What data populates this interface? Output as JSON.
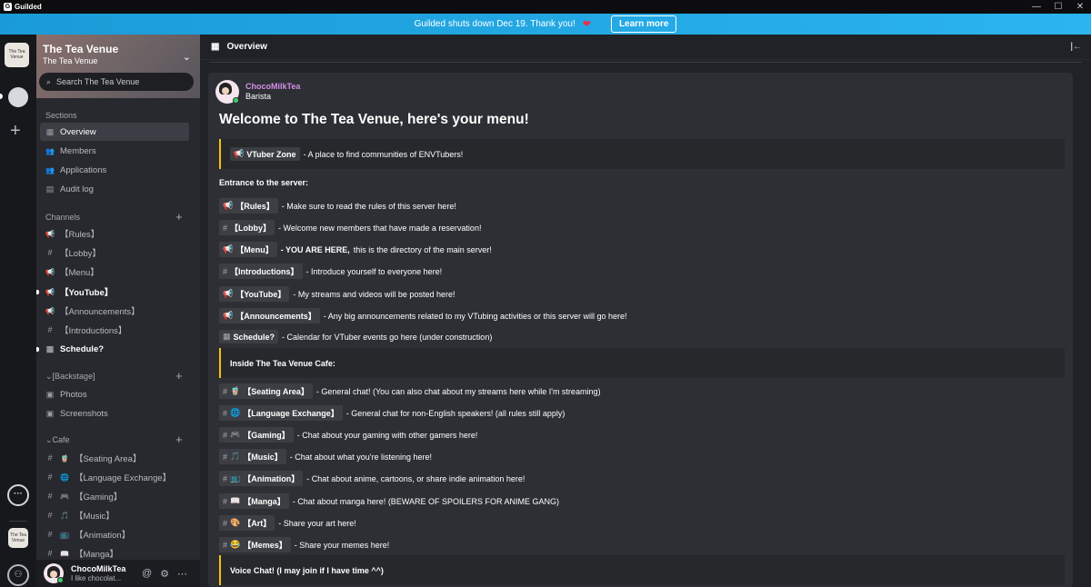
{
  "titlebar": {
    "app_name": "Guilded",
    "minimize": "—",
    "maximize": "☐",
    "close": "✕"
  },
  "banner": {
    "text": "Guilded shuts down Dec 19. Thank you!",
    "heart": "❤",
    "button": "Learn more"
  },
  "rail": {
    "server_tile_text": "The Tea Venue",
    "plus": "+",
    "chat_icon": "chat-bubble-icon"
  },
  "sidebar": {
    "server_name": "The Tea Venue",
    "server_subtitle": "The Tea Venue",
    "search_placeholder": "Search The Tea Venue",
    "sections_label": "Sections",
    "sections": [
      {
        "label": "Overview",
        "icon": "▦"
      },
      {
        "label": "Members",
        "icon": "👥"
      },
      {
        "label": "Applications",
        "icon": "👥"
      },
      {
        "label": "Audit log",
        "icon": "▤"
      }
    ],
    "channels_label": "Channels",
    "channels": [
      {
        "label": "【Rules】",
        "icon": "📢"
      },
      {
        "label": "【Lobby】",
        "icon": "#"
      },
      {
        "label": "【Menu】",
        "icon": "📢"
      },
      {
        "label": "【YouTube】",
        "icon": "📢"
      },
      {
        "label": "【Announcements】",
        "icon": "📢"
      },
      {
        "label": "【Introductions】",
        "icon": "#"
      },
      {
        "label": "Schedule?",
        "icon": "▦"
      }
    ],
    "backstage_label": "[Backstage]",
    "backstage": [
      {
        "label": "Photos",
        "icon": "▣"
      },
      {
        "label": "Screenshots",
        "icon": "▣"
      }
    ],
    "cafe_label": "Cafe",
    "cafe": [
      {
        "label": "【Seating Area】",
        "icon": "#",
        "emoji": "🧋"
      },
      {
        "label": "【Language Exchange】",
        "icon": "#",
        "emoji": "🌐"
      },
      {
        "label": "【Gaming】",
        "icon": "#",
        "emoji": "🎮"
      },
      {
        "label": "【Music】",
        "icon": "#",
        "emoji": "🎵"
      },
      {
        "label": "【Animation】",
        "icon": "#",
        "emoji": "📺"
      },
      {
        "label": "【Manga】",
        "icon": "#",
        "emoji": "📖"
      }
    ],
    "user": {
      "name": "ChocoMilkTea",
      "status": "I like chocolat...",
      "icons": [
        "@",
        "⚙",
        "⋯"
      ]
    }
  },
  "main": {
    "title": "Overview",
    "post": {
      "author": "ChocoMilkTea",
      "role": "Barista",
      "heading": "Welcome to The Tea Venue, here's your menu!",
      "vtuber_zone": {
        "tag": "VTuber Zone",
        "icon": "📢",
        "text": "- A place to find communities of ENVTubers!"
      },
      "entrance_label": "Entrance to the server:",
      "entrance": [
        {
          "icon": "📢",
          "tag": "【Rules】",
          "text": "- Make sure to read the rules of this server here!"
        },
        {
          "icon": "#",
          "tag": "【Lobby】",
          "text": "- Welcome new members that have made a reservation!"
        },
        {
          "icon": "📢",
          "tag": "【Menu】",
          "text_bold": "- YOU ARE HERE,",
          "text": "this is the directory of the main server!"
        },
        {
          "icon": "#",
          "tag": "【Introductions】",
          "text": "- Introduce yourself to everyone here!"
        },
        {
          "icon": "📢",
          "tag": "【YouTube】",
          "text": "- My streams and videos will be posted here!"
        },
        {
          "icon": "📢",
          "tag": "【Announcements】",
          "text": "- Any big announcements related to my VTubing activities or this server will go here!"
        },
        {
          "icon": "▦",
          "tag": "Schedule?",
          "text": "- Calendar for VTuber events go here (under construction)"
        }
      ],
      "cafe_label": "Inside The Tea Venue Cafe:",
      "cafe": [
        {
          "icon": "#",
          "emoji": "🧋",
          "tag": "【Seating Area】",
          "text": "- General chat! (You can also chat about my streams here while I'm streaming)"
        },
        {
          "icon": "#",
          "emoji": "🌐",
          "tag": "【Language Exchange】",
          "text": "- General chat for non-English speakers! (all rules still apply)"
        },
        {
          "icon": "#",
          "emoji": "🎮",
          "tag": "【Gaming】",
          "text": "- Chat about your gaming with other gamers here!"
        },
        {
          "icon": "#",
          "emoji": "🎵",
          "tag": "【Music】",
          "text": "- Chat about what you're listening here!"
        },
        {
          "icon": "#",
          "emoji": "📺",
          "tag": "【Animation】",
          "text": "- Chat about anime, cartoons, or share indie animation here!"
        },
        {
          "icon": "#",
          "emoji": "📖",
          "tag": "【Manga】",
          "text": "- Chat about manga here! (BEWARE OF SPOILERS FOR ANIME GANG)"
        },
        {
          "icon": "#",
          "emoji": "🎨",
          "tag": "【Art】",
          "text": "- Share your art here!"
        },
        {
          "icon": "#",
          "emoji": "😂",
          "tag": "【Memes】",
          "text": "- Share your memes here!"
        }
      ],
      "voice_label": "Voice Chat! (I may join if I have time ^^)"
    }
  },
  "colors": {
    "accent": "#f5c400",
    "banner": "#1a9bd7",
    "author": "#d38ee8",
    "online": "#3ecf63"
  }
}
